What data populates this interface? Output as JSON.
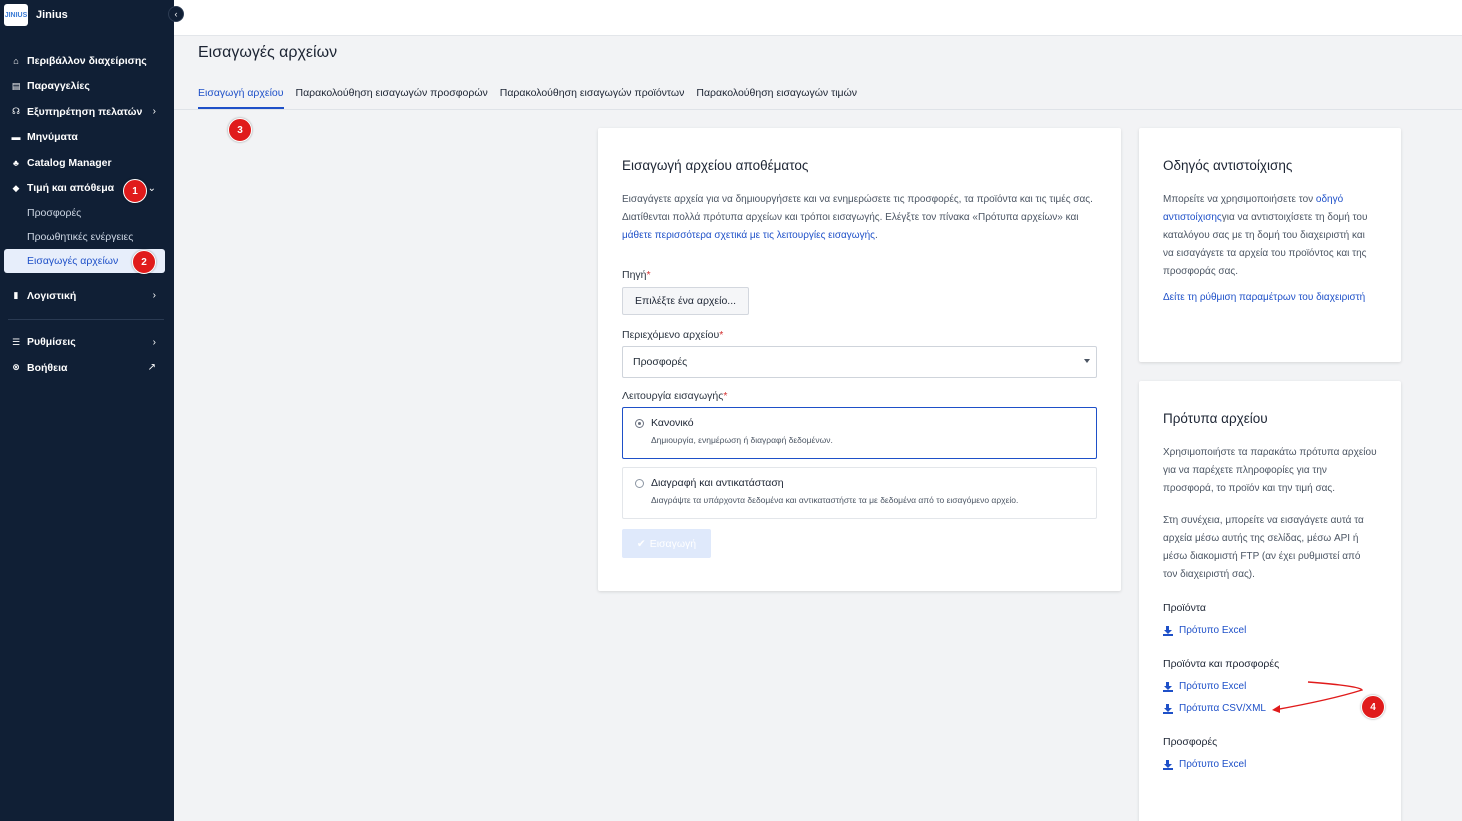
{
  "brand": {
    "logo_text": "JINIUS",
    "name": "Jinius"
  },
  "sidebar": {
    "items": [
      {
        "label": "Περιβάλλον διαχείρισης",
        "icon": "home-icon"
      },
      {
        "label": "Παραγγελίες",
        "icon": "orders-icon"
      },
      {
        "label": "Εξυπηρέτηση πελατών",
        "icon": "support-icon"
      },
      {
        "label": "Μηνύματα",
        "icon": "message-icon"
      },
      {
        "label": "Catalog Manager",
        "icon": "catalog-icon"
      },
      {
        "label": "Τιμή και απόθεμα",
        "icon": "tag-icon"
      }
    ],
    "sub_items": [
      "Προσφορές",
      "Προωθητικές ενέργειες",
      "Εισαγωγές αρχείων"
    ],
    "accounting": "Λογιστική",
    "settings": "Ρυθμίσεις",
    "help": "Βοήθεια"
  },
  "page": {
    "title": "Εισαγωγές αρχείων",
    "tabs": [
      "Εισαγωγή αρχείου",
      "Παρακολούθηση εισαγωγών προσφορών",
      "Παρακολούθηση εισαγωγών προϊόντων",
      "Παρακολούθηση εισαγωγών τιμών"
    ]
  },
  "import_card": {
    "title": "Εισαγωγή αρχείου αποθέματος",
    "desc_part1": "Εισαγάγετε αρχεία για να δημιουργήσετε και να ενημερώσετε τις προσφορές, τα προϊόντα και τις τιμές σας. Διατίθενται πολλά πρότυπα αρχείων και τρόποι εισαγωγής. Ελέγξτε τον πίνακα «Πρότυπα αρχείων» και ",
    "desc_link": "μάθετε περισσότερα σχετικά με τις λειτουργίες εισαγωγής",
    "desc_end": ".",
    "source_label": "Πηγή",
    "required_mark": "*",
    "file_button": "Επιλέξτε ένα αρχείο...",
    "content_label": "Περιεχόμενο αρχείου",
    "content_value": "Προσφορές",
    "mode_label": "Λειτουργία εισαγωγής",
    "mode_normal": "Κανονικό",
    "mode_normal_desc": "Δημιουργία, ενημέρωση ή διαγραφή δεδομένων.",
    "mode_replace": "Διαγραφή και αντικατάσταση",
    "mode_replace_desc": "Διαγράψτε τα υπάρχοντα δεδομένα και αντικαταστήστε τα με δεδομένα από το εισαγόμενο αρχείο.",
    "submit": "Εισαγωγή"
  },
  "mapping_card": {
    "title": "Οδηγός αντιστοίχισης",
    "text_part1": "Μπορείτε να χρησιμοποιήσετε τον ",
    "text_link": "οδηγό αντιστοίχισης",
    "text_part2": "για να αντιστοιχίσετε τη δομή του καταλόγου σας με τη δομή του διαχειριστή και να εισαγάγετε τα αρχεία του προϊόντος και της προσφοράς σας.",
    "config_link": "Δείτε τη ρύθμιση παραμέτρων του διαχειριστή"
  },
  "templates_card": {
    "title": "Πρότυπα αρχείου",
    "text1": "Χρησιμοποιήστε τα παρακάτω πρότυπα αρχείου για να παρέχετε πληροφορίες για την προσφορά, το προϊόν και την τιμή σας.",
    "text2": "Στη συνέχεια, μπορείτε να εισαγάγετε αυτά τα αρχεία μέσω αυτής της σελίδας, μέσω API ή μέσω διακομιστή FTP (αν έχει ρυθμιστεί από τον διαχειριστή σας).",
    "groups": [
      {
        "title": "Προϊόντα",
        "links": [
          "Πρότυπο Excel"
        ]
      },
      {
        "title": "Προϊόντα και προσφορές",
        "links": [
          "Πρότυπο Excel",
          "Πρότυπα CSV/XML"
        ]
      },
      {
        "title": "Προσφορές",
        "links": [
          "Πρότυπο Excel"
        ]
      }
    ]
  },
  "badges": [
    "1",
    "2",
    "3",
    "4"
  ],
  "colors": {
    "sidebar_bg": "#101f35",
    "accent": "#1e50c8",
    "badge": "#e01b1b"
  }
}
